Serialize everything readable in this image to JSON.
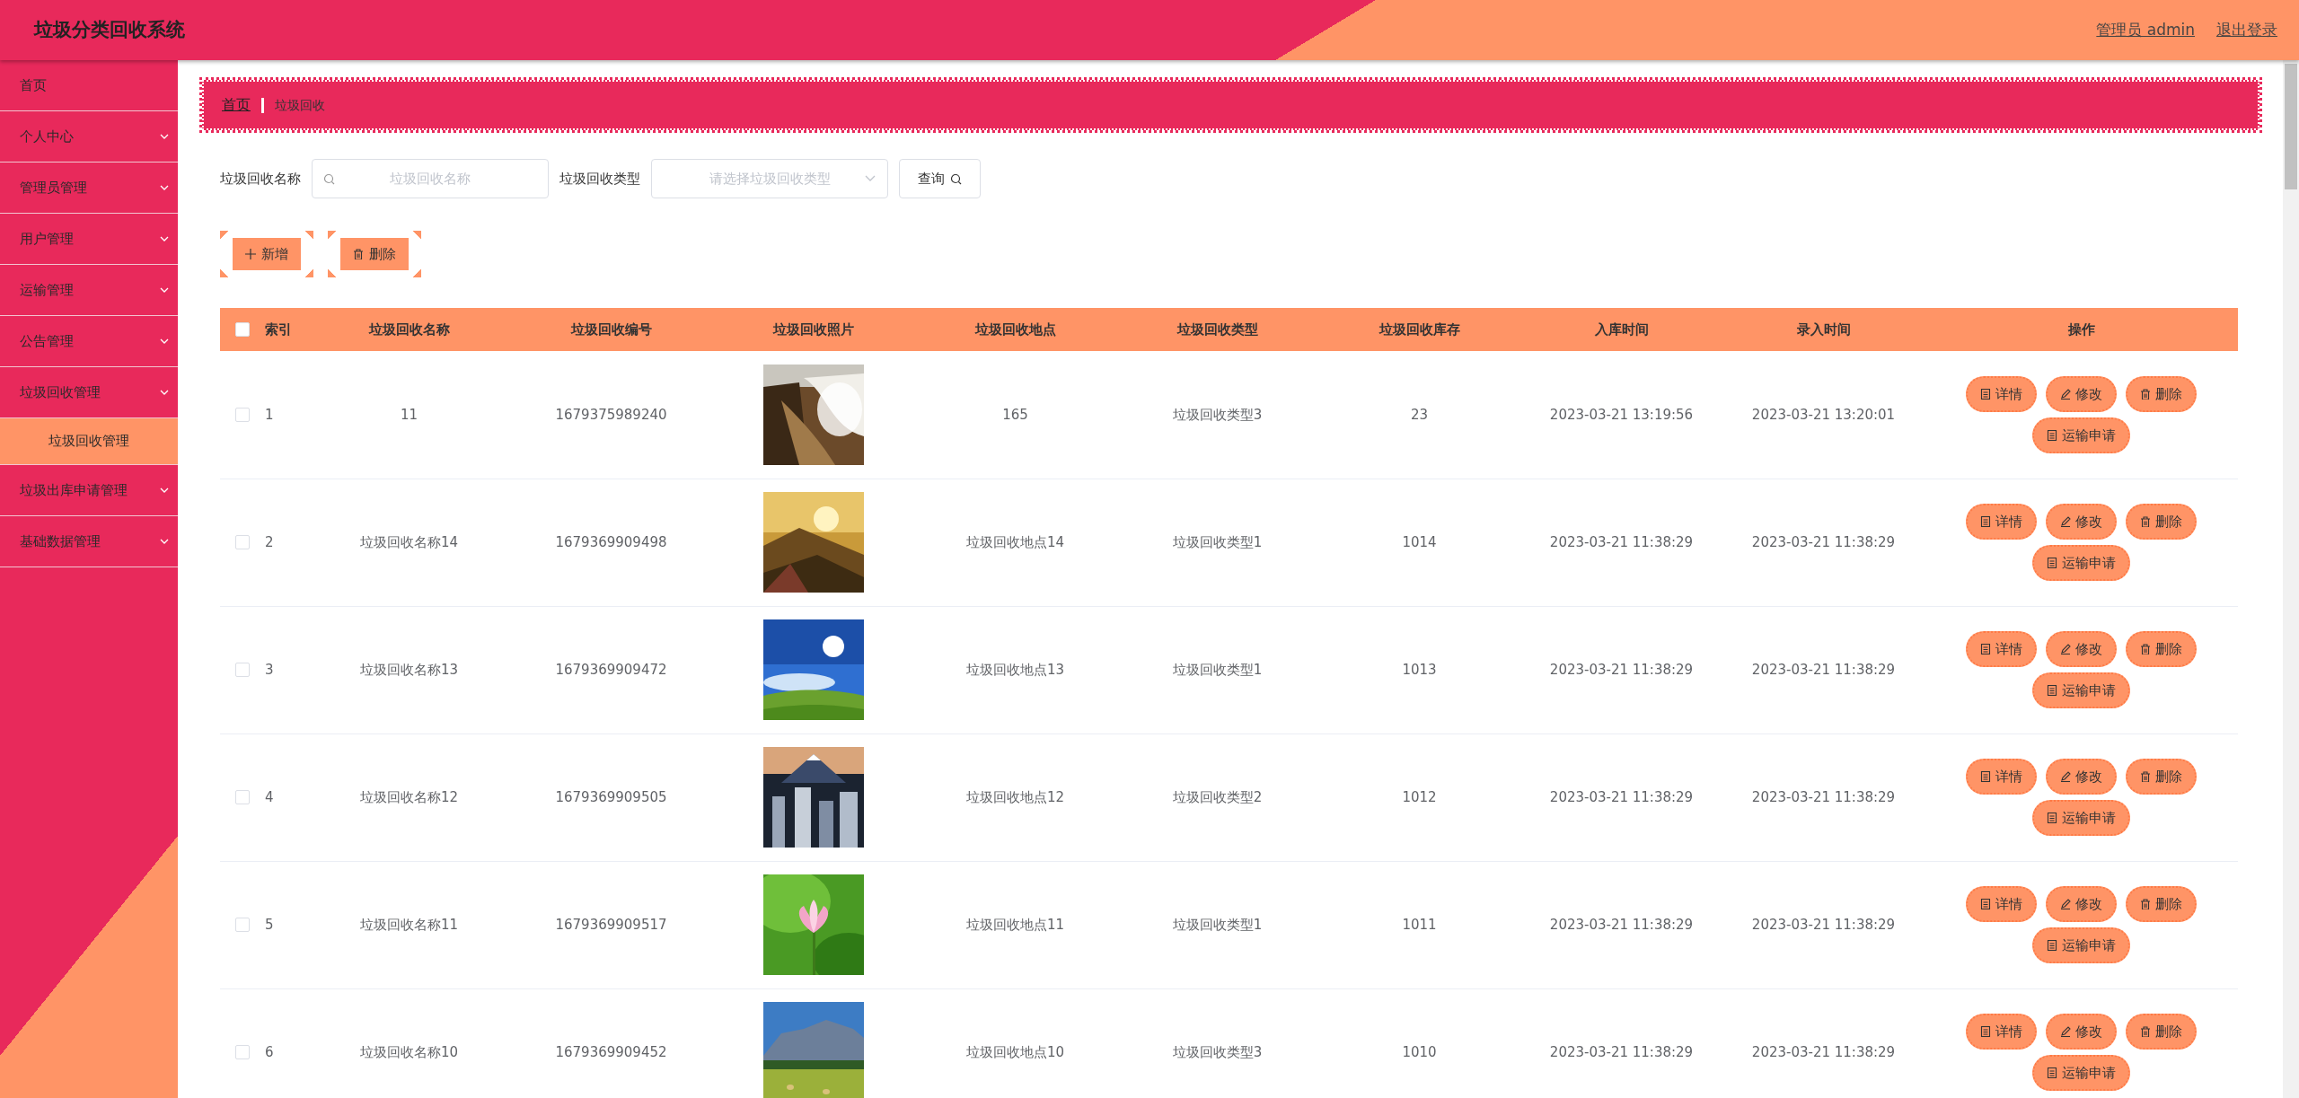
{
  "app_title": "垃圾分类回收系统",
  "user_label": "管理员 admin",
  "logout": "退出登录",
  "sidebar": {
    "items": [
      {
        "label": "首页",
        "kind": "link"
      },
      {
        "label": "个人中心",
        "kind": "menu"
      },
      {
        "label": "管理员管理",
        "kind": "menu"
      },
      {
        "label": "用户管理",
        "kind": "menu"
      },
      {
        "label": "运输管理",
        "kind": "menu"
      },
      {
        "label": "公告管理",
        "kind": "menu"
      },
      {
        "label": "垃圾回收管理",
        "kind": "menu",
        "children": [
          {
            "label": "垃圾回收管理",
            "selected": true
          }
        ]
      },
      {
        "label": "垃圾出库申请管理",
        "kind": "menu"
      },
      {
        "label": "基础数据管理",
        "kind": "menu"
      }
    ]
  },
  "breadcrumb": [
    "首页",
    "垃圾回收"
  ],
  "search": {
    "fields": [
      {
        "label": "垃圾回收名称",
        "placeholder": "垃圾回收名称",
        "kind": "text"
      },
      {
        "label": "垃圾回收类型",
        "placeholder": "请选择垃圾回收类型",
        "kind": "select"
      }
    ],
    "button": "查询"
  },
  "toolbar": [
    {
      "label": "新增",
      "kind": "add"
    },
    {
      "label": "删除",
      "kind": "delete"
    }
  ],
  "table": {
    "select_all": false,
    "columns": [
      "索引",
      "垃圾回收名称",
      "垃圾回收编号",
      "垃圾回收照片",
      "垃圾回收地点",
      "垃圾回收类型",
      "垃圾回收库存",
      "入库时间",
      "录入时间",
      "操作"
    ],
    "rows": [
      {
        "checked": false,
        "index": "1",
        "name": "11",
        "code": "1679375989240",
        "place": "165",
        "type": "垃圾回收类型3",
        "stock": "23",
        "in_time": "2023-03-21 13:19:56",
        "entry_time": "2023-03-21 13:20:01",
        "actions": [
          {
            "label": "详情",
            "kind": "detail"
          },
          {
            "label": "修改",
            "kind": "edit"
          },
          {
            "label": "删除",
            "kind": "delete"
          },
          {
            "label": "运输申请",
            "kind": "detail"
          }
        ]
      },
      {
        "checked": false,
        "index": "2",
        "name": "垃圾回收名称14",
        "code": "1679369909498",
        "place": "垃圾回收地点14",
        "type": "垃圾回收类型1",
        "stock": "1014",
        "in_time": "2023-03-21 11:38:29",
        "entry_time": "2023-03-21 11:38:29",
        "actions": [
          {
            "label": "详情",
            "kind": "detail"
          },
          {
            "label": "修改",
            "kind": "edit"
          },
          {
            "label": "删除",
            "kind": "delete"
          },
          {
            "label": "运输申请",
            "kind": "detail"
          }
        ]
      },
      {
        "checked": false,
        "index": "3",
        "name": "垃圾回收名称13",
        "code": "1679369909472",
        "place": "垃圾回收地点13",
        "type": "垃圾回收类型1",
        "stock": "1013",
        "in_time": "2023-03-21 11:38:29",
        "entry_time": "2023-03-21 11:38:29",
        "actions": [
          {
            "label": "详情",
            "kind": "detail"
          },
          {
            "label": "修改",
            "kind": "edit"
          },
          {
            "label": "删除",
            "kind": "delete"
          },
          {
            "label": "运输申请",
            "kind": "detail"
          }
        ]
      },
      {
        "checked": false,
        "index": "4",
        "name": "垃圾回收名称12",
        "code": "1679369909505",
        "place": "垃圾回收地点12",
        "type": "垃圾回收类型2",
        "stock": "1012",
        "in_time": "2023-03-21 11:38:29",
        "entry_time": "2023-03-21 11:38:29",
        "actions": [
          {
            "label": "详情",
            "kind": "detail"
          },
          {
            "label": "修改",
            "kind": "edit"
          },
          {
            "label": "删除",
            "kind": "delete"
          },
          {
            "label": "运输申请",
            "kind": "detail"
          }
        ]
      },
      {
        "checked": false,
        "index": "5",
        "name": "垃圾回收名称11",
        "code": "1679369909517",
        "place": "垃圾回收地点11",
        "type": "垃圾回收类型1",
        "stock": "1011",
        "in_time": "2023-03-21 11:38:29",
        "entry_time": "2023-03-21 11:38:29",
        "actions": [
          {
            "label": "详情",
            "kind": "detail"
          },
          {
            "label": "修改",
            "kind": "edit"
          },
          {
            "label": "删除",
            "kind": "delete"
          },
          {
            "label": "运输申请",
            "kind": "detail"
          }
        ]
      },
      {
        "checked": false,
        "index": "6",
        "name": "垃圾回收名称10",
        "code": "1679369909452",
        "place": "垃圾回收地点10",
        "type": "垃圾回收类型3",
        "stock": "1010",
        "in_time": "2023-03-21 11:38:29",
        "entry_time": "2023-03-21 11:38:29",
        "actions": [
          {
            "label": "详情",
            "kind": "detail"
          },
          {
            "label": "修改",
            "kind": "edit"
          },
          {
            "label": "删除",
            "kind": "delete"
          },
          {
            "label": "运输申请",
            "kind": "detail"
          }
        ]
      }
    ]
  }
}
